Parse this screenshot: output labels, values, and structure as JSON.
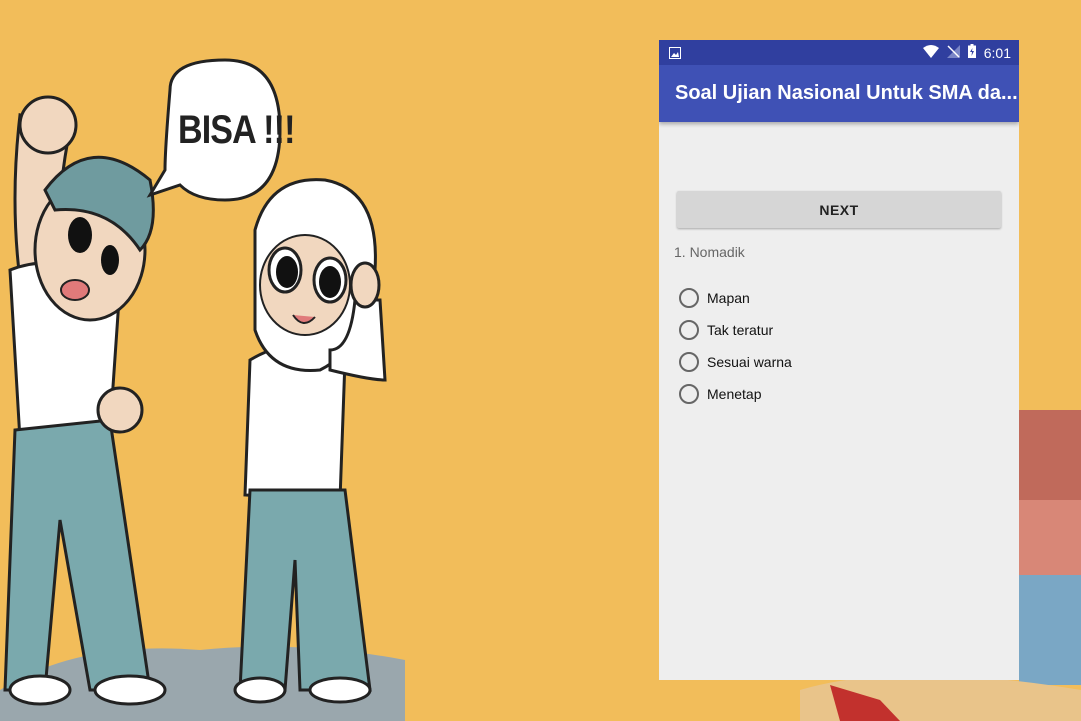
{
  "background": {
    "speech_bubble": "BISA !!!",
    "colors": {
      "bg": "#f2bd5a",
      "pants": "#7aa9ad"
    }
  },
  "status_bar": {
    "time": "6:01",
    "icons": [
      "image-icon",
      "wifi-icon",
      "no-signal-icon",
      "battery-icon"
    ]
  },
  "app_bar": {
    "title": "Soal Ujian Nasional Untuk SMA da..."
  },
  "quiz": {
    "next_label": "NEXT",
    "question": "1. Nomadik",
    "options": [
      "Mapan",
      "Tak teratur",
      "Sesuai warna",
      "Menetap"
    ]
  },
  "colors": {
    "primary": "#3f51b5",
    "primary_dark": "#303f9f"
  }
}
